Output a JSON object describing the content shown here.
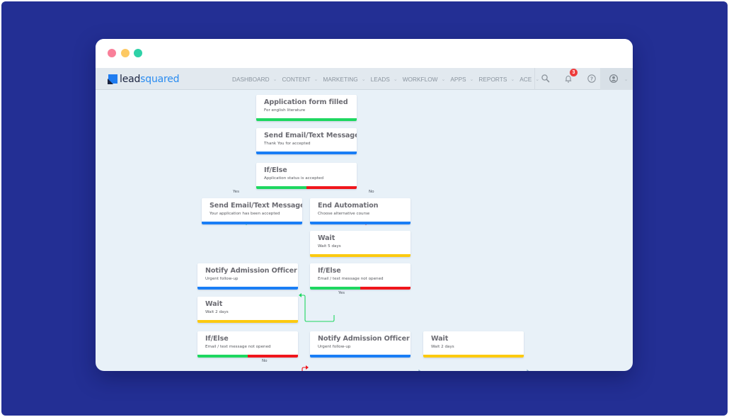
{
  "window": {
    "controls": [
      {
        "name": "close",
        "color": "#f97f99"
      },
      {
        "name": "minimize",
        "color": "#fdc963"
      },
      {
        "name": "maximize",
        "color": "#2ed1a7"
      }
    ]
  },
  "brand": {
    "part1": "lead",
    "part2": "squared"
  },
  "nav": {
    "items": [
      {
        "label": "DASHBOARD"
      },
      {
        "label": "CONTENT"
      },
      {
        "label": "MARKETING"
      },
      {
        "label": "LEADS"
      },
      {
        "label": "WORKFLOW"
      },
      {
        "label": "APPS"
      },
      {
        "label": "REPORTS"
      },
      {
        "label": "ACE"
      }
    ],
    "chevron": "⌄",
    "icons": {
      "search": "search-icon",
      "notifications": "bell-icon",
      "help": "help-icon",
      "profile": "user-icon"
    },
    "notification_count": "3"
  },
  "colors": {
    "green": "#1ed760",
    "blue": "#1a7ef5",
    "red": "#f0161c",
    "yellow": "#fcca10",
    "connector": "#8fb0c9"
  },
  "workflow": {
    "nodes": [
      {
        "id": "n1",
        "title": "Application form filled",
        "subtitle": "For english literature",
        "bar": [
          "green"
        ]
      },
      {
        "id": "n2",
        "title": "Send Email/Text Message",
        "subtitle": "Thank You for accepted",
        "bar": [
          "blue"
        ]
      },
      {
        "id": "n3",
        "title": "If/Else",
        "subtitle": "Application status is accepted",
        "bar": [
          "green",
          "red"
        ]
      },
      {
        "id": "n4",
        "title": "Send Email/Text Message",
        "subtitle": "Your application has been accepted",
        "bar": [
          "blue"
        ]
      },
      {
        "id": "n5",
        "title": "End Automation",
        "subtitle": "Choose alternative course",
        "bar": [
          "blue"
        ]
      },
      {
        "id": "n6",
        "title": "Wait",
        "subtitle": "Wait 5 days",
        "bar": [
          "yellow"
        ]
      },
      {
        "id": "n7",
        "title": "Notify Admission Officer",
        "subtitle": "Urgent follow-up",
        "bar": [
          "blue"
        ]
      },
      {
        "id": "n8",
        "title": "If/Else",
        "subtitle": "Email / text message not opened",
        "bar": [
          "green",
          "red"
        ]
      },
      {
        "id": "n9",
        "title": "Wait",
        "subtitle": "Wait 2 days",
        "bar": [
          "yellow"
        ]
      },
      {
        "id": "n10",
        "title": "If/Else",
        "subtitle": "Email / text message not opened",
        "bar": [
          "green",
          "red"
        ]
      },
      {
        "id": "n11",
        "title": "Notify Admission Officer",
        "subtitle": "Urgent follow-up",
        "bar": [
          "blue"
        ]
      },
      {
        "id": "n12",
        "title": "Wait",
        "subtitle": "Wait 2 days",
        "bar": [
          "yellow"
        ]
      }
    ],
    "branch_labels": {
      "yes1": "Yes",
      "no1": "No",
      "yes2": "Yes",
      "no2": "No"
    }
  }
}
